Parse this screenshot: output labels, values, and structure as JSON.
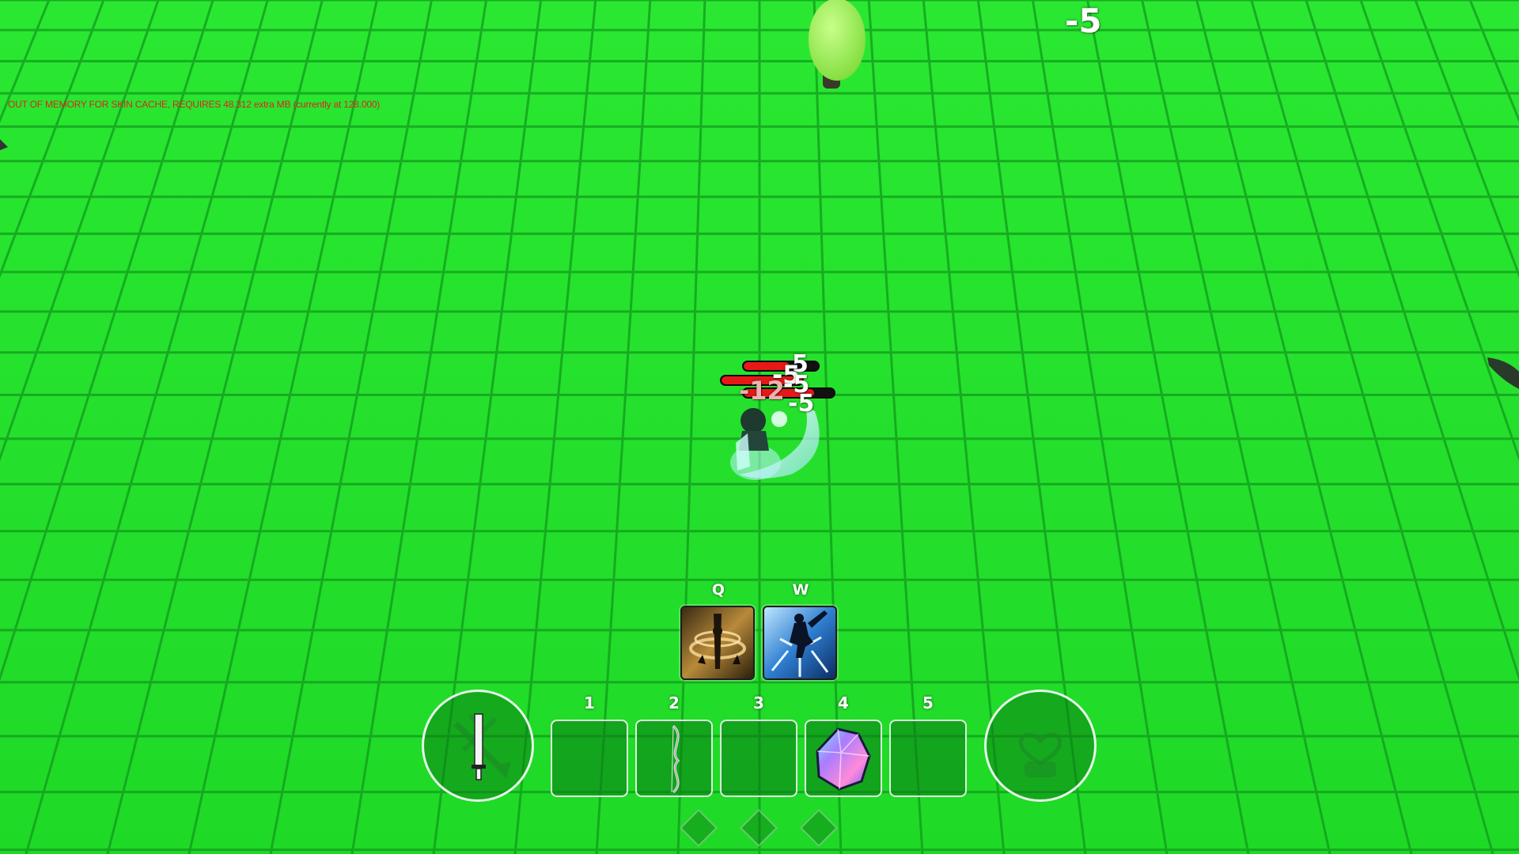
{
  "debug": {
    "message": "OUT OF MEMORY FOR SKIN CACHE, REQUIRES 48.312 extra MB (currently at 128.000)"
  },
  "damage_numbers": {
    "top_right": "-5",
    "stack_1": "-5",
    "stack_2": "-5",
    "stack_3": "-12",
    "stack_4": "5",
    "stack_5": "-5"
  },
  "skills": [
    {
      "key": "Q",
      "icon": "whirlwind-sword-icon"
    },
    {
      "key": "W",
      "icon": "leap-strike-icon"
    }
  ],
  "inventory": {
    "slots": [
      {
        "number": "1",
        "item": ""
      },
      {
        "number": "2",
        "item": "bow-icon"
      },
      {
        "number": "3",
        "item": ""
      },
      {
        "number": "4",
        "item": "crystal-gem-icon"
      },
      {
        "number": "5",
        "item": ""
      }
    ],
    "weapon_slot_icon": "sword-icon",
    "armor_slot_icon": "armor-heart-icon",
    "page_count": 3
  },
  "colors": {
    "ground": "#22e32a",
    "grid_line": "#129a1c",
    "hp_red": "#e81818"
  }
}
